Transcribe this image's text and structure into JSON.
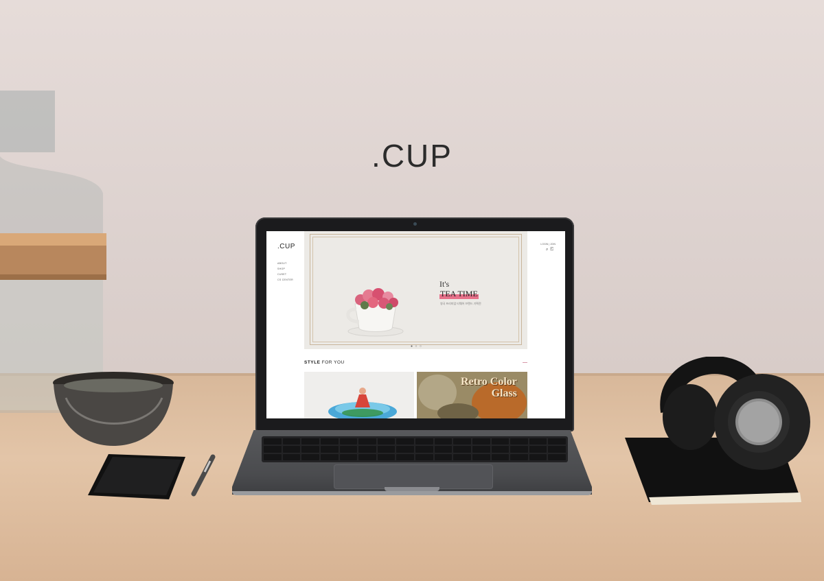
{
  "scene": {
    "brand_title": ".CUP"
  },
  "website": {
    "logo": ".CUP",
    "nav": [
      "ABOUT",
      "SHOP",
      "CUSET",
      "CS CENTER"
    ],
    "auth": "LOGIN | JOIN",
    "header_icons": [
      "search-icon",
      "bag-icon"
    ],
    "hero": {
      "line1": "It's",
      "line2": "TEA TIME",
      "subtitle": "영국 프리미엄 티웨어 브랜드 기획전",
      "slide_dots": "● ○ ○"
    },
    "section": {
      "title_bold": "STYLE",
      "title_rest": " FOR YOU",
      "more": "—"
    },
    "cards": [
      {
        "title": ""
      },
      {
        "title": "Retro Color Glass",
        "line1": "Retro Color",
        "line2": "Glass"
      }
    ]
  },
  "colors": {
    "accent_pink": "#e7718a",
    "frame_gold": "#c8b49a"
  }
}
